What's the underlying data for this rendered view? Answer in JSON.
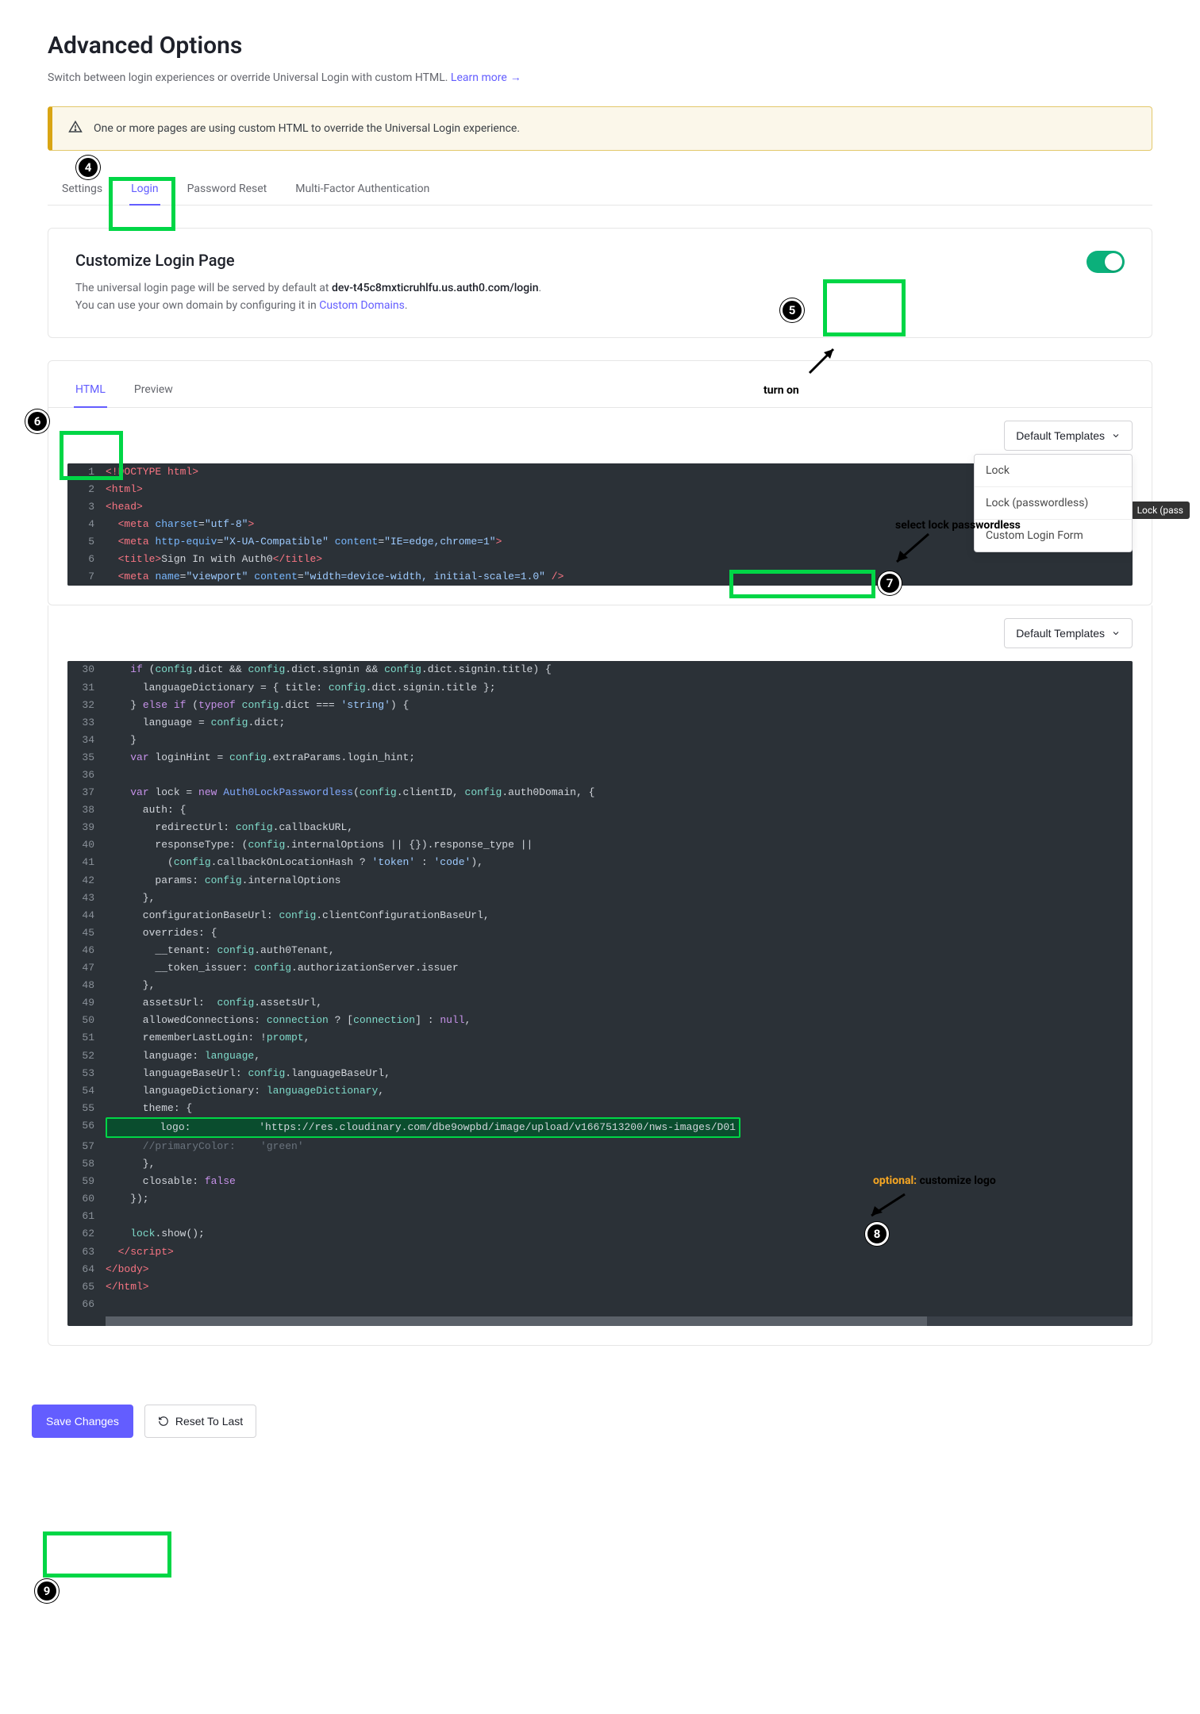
{
  "page": {
    "title": "Advanced Options",
    "subtitle_prefix": "Switch between login experiences or override Universal Login with custom HTML. ",
    "learn_more": "Learn more"
  },
  "alert": {
    "text": "One or more pages are using custom HTML to override the Universal Login experience."
  },
  "tabs": {
    "settings": "Settings",
    "login": "Login",
    "password_reset": "Password Reset",
    "mfa": "Multi-Factor Authentication"
  },
  "customize": {
    "heading": "Customize Login Page",
    "line1_prefix": "The universal login page will be served by default at ",
    "domain": "dev-t45c8mxticruhlfu.us.auth0.com/login",
    "line2_prefix": "You can use your own domain by configuring it in ",
    "custom_domains": "Custom Domains"
  },
  "editor": {
    "tab_html": "HTML",
    "tab_preview": "Preview",
    "default_templates": "Default Templates",
    "menu": {
      "lock": "Lock",
      "lock_passwordless": "Lock (passwordless)",
      "custom_login_form": "Custom Login Form"
    },
    "tooltip": "Lock (pass"
  },
  "code_top": [
    {
      "n": "1",
      "tokens": [
        [
          "tag",
          "<!DOCTYPE html>"
        ]
      ]
    },
    {
      "n": "2",
      "tokens": [
        [
          "tag",
          "<html>"
        ]
      ]
    },
    {
      "n": "3",
      "tokens": [
        [
          "tag",
          "<head>"
        ]
      ]
    },
    {
      "n": "4",
      "tokens": [
        [
          "ident",
          "  "
        ],
        [
          "tag",
          "<meta"
        ],
        [
          "ident",
          " "
        ],
        [
          "attr",
          "charset"
        ],
        [
          "ident",
          "="
        ],
        [
          "str",
          "\"utf-8\""
        ],
        [
          "tag",
          ">"
        ]
      ]
    },
    {
      "n": "5",
      "tokens": [
        [
          "ident",
          "  "
        ],
        [
          "tag",
          "<meta"
        ],
        [
          "ident",
          " "
        ],
        [
          "attr",
          "http-equiv"
        ],
        [
          "ident",
          "="
        ],
        [
          "str",
          "\"X-UA-Compatible\""
        ],
        [
          "ident",
          " "
        ],
        [
          "attr",
          "content"
        ],
        [
          "ident",
          "="
        ],
        [
          "str",
          "\"IE=edge,chrome=1\""
        ],
        [
          "tag",
          ">"
        ]
      ]
    },
    {
      "n": "6",
      "tokens": [
        [
          "ident",
          "  "
        ],
        [
          "tag",
          "<title>"
        ],
        [
          "ident",
          "Sign In with Auth0"
        ],
        [
          "tag",
          "</title>"
        ]
      ]
    },
    {
      "n": "7",
      "tokens": [
        [
          "ident",
          "  "
        ],
        [
          "tag",
          "<meta"
        ],
        [
          "ident",
          " "
        ],
        [
          "attr",
          "name"
        ],
        [
          "ident",
          "="
        ],
        [
          "str",
          "\"viewport\""
        ],
        [
          "ident",
          " "
        ],
        [
          "attr",
          "content"
        ],
        [
          "ident",
          "="
        ],
        [
          "str",
          "\"width=device-width, initial-scale=1.0\""
        ],
        [
          "ident",
          " "
        ],
        [
          "tag",
          "/>"
        ]
      ]
    }
  ],
  "code_bottom": [
    {
      "n": "30",
      "tokens": [
        [
          "ident",
          "    "
        ],
        [
          "kw",
          "if"
        ],
        [
          "ident",
          " ("
        ],
        [
          "prop",
          "config"
        ],
        [
          "ident",
          ".dict && "
        ],
        [
          "prop",
          "config"
        ],
        [
          "ident",
          ".dict.signin && "
        ],
        [
          "prop",
          "config"
        ],
        [
          "ident",
          ".dict.signin.title) {"
        ]
      ]
    },
    {
      "n": "31",
      "tokens": [
        [
          "ident",
          "      languageDictionary = { title: "
        ],
        [
          "prop",
          "config"
        ],
        [
          "ident",
          ".dict.signin.title };"
        ]
      ]
    },
    {
      "n": "32",
      "tokens": [
        [
          "ident",
          "    } "
        ],
        [
          "kw",
          "else if"
        ],
        [
          "ident",
          " ("
        ],
        [
          "kw",
          "typeof"
        ],
        [
          "ident",
          " "
        ],
        [
          "prop",
          "config"
        ],
        [
          "ident",
          ".dict === "
        ],
        [
          "str",
          "'string'"
        ],
        [
          "ident",
          ") {"
        ]
      ]
    },
    {
      "n": "33",
      "tokens": [
        [
          "ident",
          "      language = "
        ],
        [
          "prop",
          "config"
        ],
        [
          "ident",
          ".dict;"
        ]
      ]
    },
    {
      "n": "34",
      "tokens": [
        [
          "ident",
          "    }"
        ]
      ]
    },
    {
      "n": "35",
      "tokens": [
        [
          "ident",
          "    "
        ],
        [
          "kw",
          "var"
        ],
        [
          "ident",
          " loginHint = "
        ],
        [
          "prop",
          "config"
        ],
        [
          "ident",
          ".extraParams.login_hint;"
        ]
      ]
    },
    {
      "n": "36",
      "tokens": [
        [
          "ident",
          ""
        ]
      ]
    },
    {
      "n": "37",
      "tokens": [
        [
          "ident",
          "    "
        ],
        [
          "kw",
          "var"
        ],
        [
          "ident",
          " lock = "
        ],
        [
          "kw",
          "new"
        ],
        [
          "ident",
          " "
        ],
        [
          "fn",
          "Auth0LockPasswordless"
        ],
        [
          "ident",
          "("
        ],
        [
          "prop",
          "config"
        ],
        [
          "ident",
          ".clientID, "
        ],
        [
          "prop",
          "config"
        ],
        [
          "ident",
          ".auth0Domain, {"
        ]
      ]
    },
    {
      "n": "38",
      "tokens": [
        [
          "ident",
          "      auth: {"
        ]
      ]
    },
    {
      "n": "39",
      "tokens": [
        [
          "ident",
          "        redirectUrl: "
        ],
        [
          "prop",
          "config"
        ],
        [
          "ident",
          ".callbackURL,"
        ]
      ]
    },
    {
      "n": "40",
      "tokens": [
        [
          "ident",
          "        responseType: ("
        ],
        [
          "prop",
          "config"
        ],
        [
          "ident",
          ".internalOptions || {}).response_type ||"
        ]
      ]
    },
    {
      "n": "41",
      "tokens": [
        [
          "ident",
          "          ("
        ],
        [
          "prop",
          "config"
        ],
        [
          "ident",
          ".callbackOnLocationHash ? "
        ],
        [
          "str",
          "'token'"
        ],
        [
          "ident",
          " : "
        ],
        [
          "str",
          "'code'"
        ],
        [
          "ident",
          "),"
        ]
      ]
    },
    {
      "n": "42",
      "tokens": [
        [
          "ident",
          "        params: "
        ],
        [
          "prop",
          "config"
        ],
        [
          "ident",
          ".internalOptions"
        ]
      ]
    },
    {
      "n": "43",
      "tokens": [
        [
          "ident",
          "      },"
        ]
      ]
    },
    {
      "n": "44",
      "tokens": [
        [
          "ident",
          "      configurationBaseUrl: "
        ],
        [
          "prop",
          "config"
        ],
        [
          "ident",
          ".clientConfigurationBaseUrl,"
        ]
      ]
    },
    {
      "n": "45",
      "tokens": [
        [
          "ident",
          "      overrides: {"
        ]
      ]
    },
    {
      "n": "46",
      "tokens": [
        [
          "ident",
          "        __tenant: "
        ],
        [
          "prop",
          "config"
        ],
        [
          "ident",
          ".auth0Tenant,"
        ]
      ]
    },
    {
      "n": "47",
      "tokens": [
        [
          "ident",
          "        __token_issuer: "
        ],
        [
          "prop",
          "config"
        ],
        [
          "ident",
          ".authorizationServer.issuer"
        ]
      ]
    },
    {
      "n": "48",
      "tokens": [
        [
          "ident",
          "      },"
        ]
      ]
    },
    {
      "n": "49",
      "tokens": [
        [
          "ident",
          "      assetsUrl:  "
        ],
        [
          "prop",
          "config"
        ],
        [
          "ident",
          ".assetsUrl,"
        ]
      ]
    },
    {
      "n": "50",
      "tokens": [
        [
          "ident",
          "      allowedConnections: "
        ],
        [
          "prop",
          "connection"
        ],
        [
          "ident",
          " ? ["
        ],
        [
          "prop",
          "connection"
        ],
        [
          "ident",
          "] : "
        ],
        [
          "kw",
          "null"
        ],
        [
          "ident",
          ","
        ]
      ]
    },
    {
      "n": "51",
      "tokens": [
        [
          "ident",
          "      rememberLastLogin: !"
        ],
        [
          "prop",
          "prompt"
        ],
        [
          "ident",
          ","
        ]
      ]
    },
    {
      "n": "52",
      "tokens": [
        [
          "ident",
          "      language: "
        ],
        [
          "prop",
          "language"
        ],
        [
          "ident",
          ","
        ]
      ]
    },
    {
      "n": "53",
      "tokens": [
        [
          "ident",
          "      languageBaseUrl: "
        ],
        [
          "prop",
          "config"
        ],
        [
          "ident",
          ".languageBaseUrl,"
        ]
      ]
    },
    {
      "n": "54",
      "tokens": [
        [
          "ident",
          "      languageDictionary: "
        ],
        [
          "prop",
          "languageDictionary"
        ],
        [
          "ident",
          ","
        ]
      ]
    },
    {
      "n": "55",
      "tokens": [
        [
          "ident",
          "      theme: {"
        ]
      ]
    },
    {
      "n": "56",
      "tokens": [
        [
          "hl",
          "        logo:           'https://res.cloudinary.com/dbe9owpbd/image/upload/v1667513200/nws-images/D01"
        ]
      ]
    },
    {
      "n": "57",
      "tokens": [
        [
          "comment",
          "      //primaryColor:    'green'"
        ]
      ]
    },
    {
      "n": "58",
      "tokens": [
        [
          "ident",
          "      },"
        ]
      ]
    },
    {
      "n": "59",
      "tokens": [
        [
          "ident",
          "      closable: "
        ],
        [
          "kw",
          "false"
        ]
      ]
    },
    {
      "n": "60",
      "tokens": [
        [
          "ident",
          "    });"
        ]
      ]
    },
    {
      "n": "61",
      "tokens": [
        [
          "ident",
          ""
        ]
      ]
    },
    {
      "n": "62",
      "tokens": [
        [
          "ident",
          "    "
        ],
        [
          "prop",
          "lock"
        ],
        [
          "ident",
          ".show();"
        ]
      ]
    },
    {
      "n": "63",
      "tokens": [
        [
          "ident",
          "  "
        ],
        [
          "tag",
          "</script>"
        ]
      ]
    },
    {
      "n": "64",
      "tokens": [
        [
          "tag",
          "</body>"
        ]
      ]
    },
    {
      "n": "65",
      "tokens": [
        [
          "tag",
          "</html>"
        ]
      ]
    },
    {
      "n": "66",
      "tokens": [
        [
          "ident",
          ""
        ]
      ]
    }
  ],
  "buttons": {
    "save": "Save Changes",
    "reset": "Reset To Last"
  },
  "annotations": {
    "b4": "4",
    "b5": "5",
    "b6": "6",
    "b7": "7",
    "b8": "8",
    "b9": "9",
    "turn_on": "turn on",
    "select_lock": "select lock passwordless",
    "customize_logo_opt": "optional:",
    "customize_logo": " customize logo"
  }
}
